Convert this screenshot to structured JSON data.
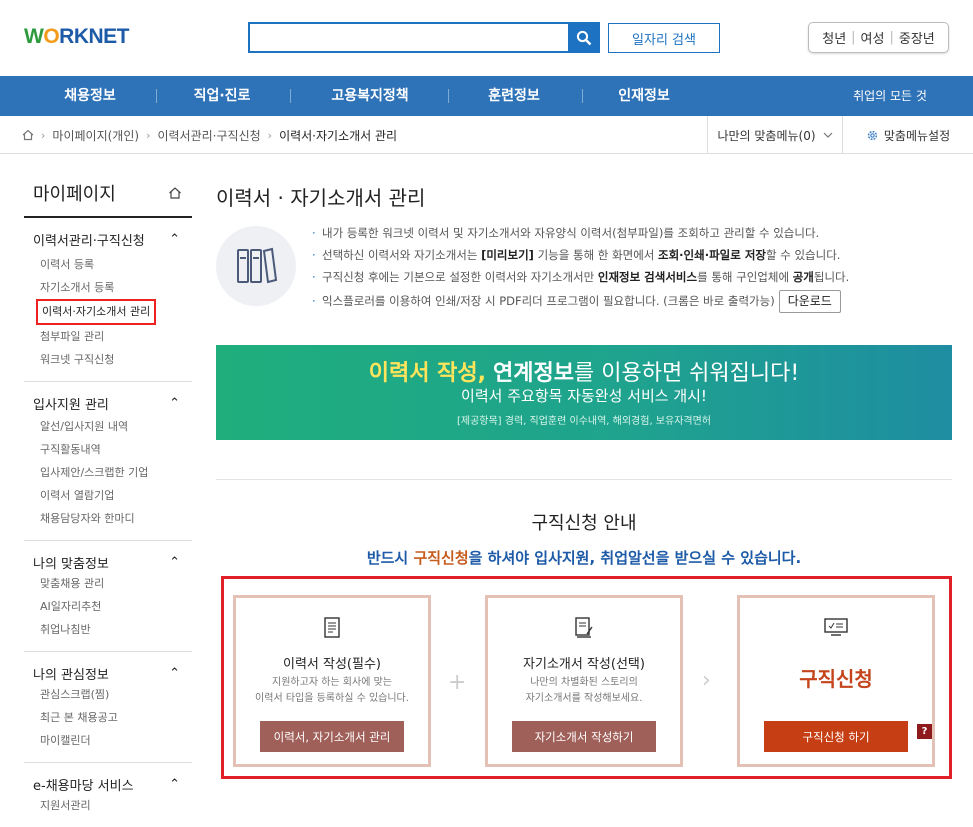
{
  "header": {
    "logo": "WORKNET",
    "search_placeholder": "",
    "job_search_label": "일자리 검색",
    "audience": [
      "청년",
      "여성",
      "중장년"
    ]
  },
  "nav": {
    "items": [
      "채용정보",
      "직업·진로",
      "고용복지정책",
      "훈련정보",
      "인재정보"
    ],
    "right": "취업의 모든 것"
  },
  "breadcrumb": {
    "items": [
      "마이페이지(개인)",
      "이력서관리·구직신청",
      "이력서·자기소개서 관리"
    ],
    "my_menu": "나만의 맞춤메뉴(0)",
    "my_menu_settings": "맞춤메뉴설정"
  },
  "sidebar": {
    "title": "마이페이지",
    "groups": [
      {
        "title": "이력서관리·구직신청",
        "items": [
          "이력서 등록",
          "자기소개서 등록",
          "이력서·자기소개서 관리",
          "첨부파일 관리",
          "워크넷 구직신청"
        ]
      },
      {
        "title": "입사지원 관리",
        "items": [
          "알선/입사지원 내역",
          "구직활동내역",
          "입사제안/스크랩한 기업",
          "이력서 열람기업",
          "채용담당자와 한마디"
        ]
      },
      {
        "title": "나의 맞춤정보",
        "items": [
          "맞춤채용 관리",
          "AI일자리추천",
          "취업나침반"
        ]
      },
      {
        "title": "나의 관심정보",
        "items": [
          "관심스크랩(찜)",
          "최근 본 채용공고",
          "마이캘린더"
        ]
      },
      {
        "title": "e-채용마당 서비스",
        "items": [
          "지원서관리"
        ]
      }
    ]
  },
  "main": {
    "title": "이력서 · 자기소개서 관리",
    "intro": [
      {
        "a": "내가 등록한 워크넷 이력서 및 자기소개서와 자유양식 이력서(첨부파일)를 조회하고 관리할 수 있습니다."
      },
      {
        "a": "선택하신 이력서와 자기소개서는 ",
        "b": "[미리보기]",
        "c": " 기능을 통해 한 화면에서 ",
        "d": "조회·인쇄·파일로 저장",
        "e": "할 수 있습니다."
      },
      {
        "a": "구직신청 후에는 기본으로 설정한 이력서와 자기소개서만 ",
        "b": "인재정보 검색서비스",
        "c": "를 통해 구인업체에 ",
        "d": "공개",
        "e": "됩니다."
      },
      {
        "a": "익스플로러를 이용하여 인쇄/저장 시 PDF리더 프로그램이 필요합니다. (크롬은 바로 출력가능)"
      }
    ],
    "download_label": "다운로드",
    "banner": {
      "y1": "이력서 작성,",
      "b1": "연계정보",
      "rest": "를 이용하면 쉬워집니다!",
      "line2": "이력서 주요항목 자동완성 서비스 개시!",
      "line3": "[제공항목] 경력, 직업훈련 이수내역, 해외경험, 보유자격면허"
    },
    "guide_title": "구직신청 안내",
    "guide_sub": {
      "a": "반드시 ",
      "b": "구직신청",
      "c": "을 하셔야 입사지원, 취업알선을 받으실 수 있습니다."
    },
    "steps": [
      {
        "title": "이력서 작성(필수)",
        "desc1": "지원하고자 하는 회사에 맞는",
        "desc2": "이력서 타입을 등록하실 수 있습니다.",
        "button": "이력서, 자기소개서 관리"
      },
      {
        "title": "자기소개서 작성(선택)",
        "desc1": "나만의 차별화된 스토리의",
        "desc2": "자기소개서를 작성해보세요.",
        "button": "자기소개서 작성하기"
      },
      {
        "big": "구직신청",
        "button": "구직신청 하기",
        "help": "?"
      }
    ]
  },
  "colors": {
    "brand_blue": "#2e72b8",
    "highlight_red": "#e01f26",
    "step_button": "#a0605a",
    "apply_button": "#c63f14"
  }
}
